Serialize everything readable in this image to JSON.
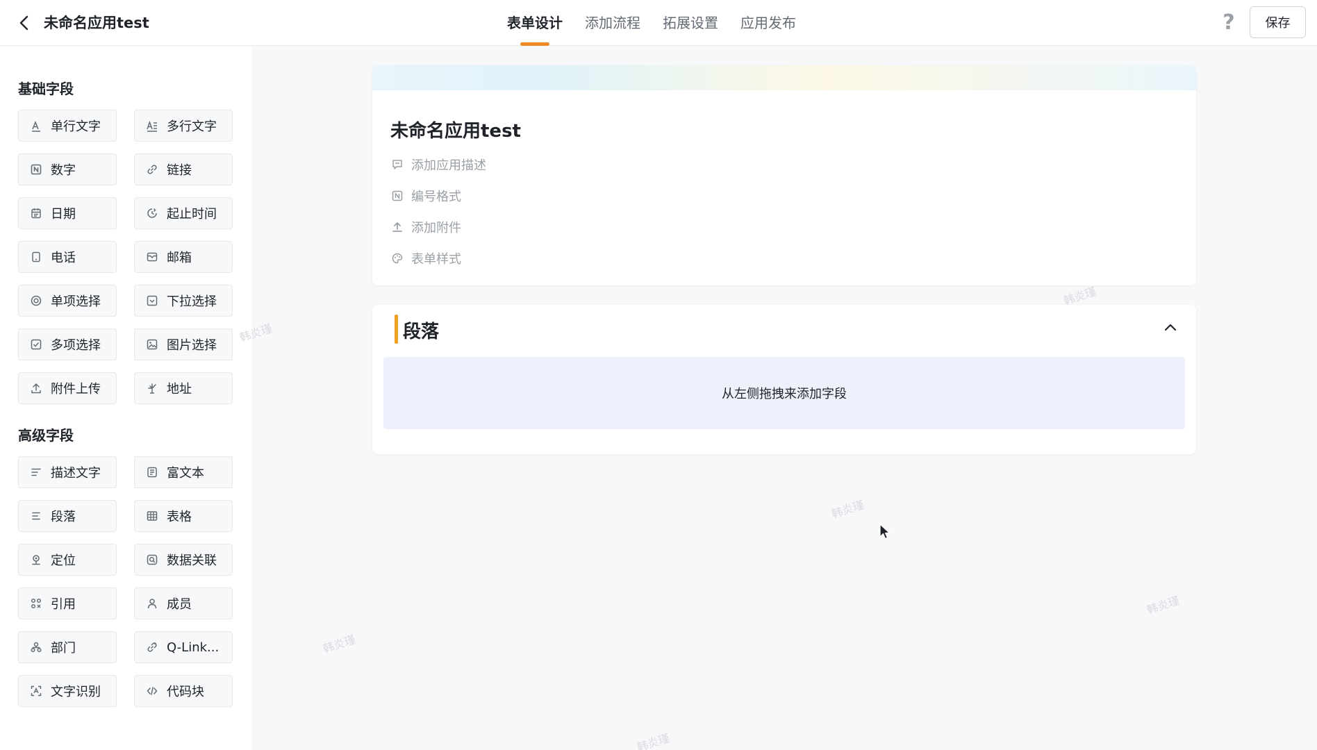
{
  "header": {
    "title": "未命名应用test",
    "tabs": [
      {
        "label": "表单设计",
        "active": true
      },
      {
        "label": "添加流程",
        "active": false
      },
      {
        "label": "拓展设置",
        "active": false
      },
      {
        "label": "应用发布",
        "active": false
      }
    ],
    "help": "?",
    "save_label": "保存"
  },
  "sidebar": {
    "basic_title": "基础字段",
    "basic_fields": [
      {
        "label": "单行文字",
        "icon": "text-icon"
      },
      {
        "label": "多行文字",
        "icon": "multiline-text-icon"
      },
      {
        "label": "数字",
        "icon": "number-icon"
      },
      {
        "label": "链接",
        "icon": "link-icon"
      },
      {
        "label": "日期",
        "icon": "calendar-icon"
      },
      {
        "label": "起止时间",
        "icon": "time-range-icon"
      },
      {
        "label": "电话",
        "icon": "phone-icon"
      },
      {
        "label": "邮箱",
        "icon": "mail-icon"
      },
      {
        "label": "单项选择",
        "icon": "radio-icon"
      },
      {
        "label": "下拉选择",
        "icon": "dropdown-icon"
      },
      {
        "label": "多项选择",
        "icon": "checkbox-icon"
      },
      {
        "label": "图片选择",
        "icon": "image-icon"
      },
      {
        "label": "附件上传",
        "icon": "upload-icon"
      },
      {
        "label": "地址",
        "icon": "address-icon"
      }
    ],
    "advanced_title": "高级字段",
    "advanced_fields": [
      {
        "label": "描述文字",
        "icon": "description-icon"
      },
      {
        "label": "富文本",
        "icon": "rich-text-icon"
      },
      {
        "label": "段落",
        "icon": "paragraph-icon"
      },
      {
        "label": "表格",
        "icon": "table-icon"
      },
      {
        "label": "定位",
        "icon": "location-icon"
      },
      {
        "label": "数据关联",
        "icon": "data-link-icon"
      },
      {
        "label": "引用",
        "icon": "reference-icon"
      },
      {
        "label": "成员",
        "icon": "member-icon"
      },
      {
        "label": "部门",
        "icon": "department-icon"
      },
      {
        "label": "Q-Link...",
        "icon": "qlink-icon"
      },
      {
        "label": "文字识别",
        "icon": "ocr-icon"
      },
      {
        "label": "代码块",
        "icon": "code-icon"
      }
    ]
  },
  "form": {
    "title": "未命名应用test",
    "options": [
      {
        "label": "添加应用描述",
        "icon": "comment-icon"
      },
      {
        "label": "编号格式",
        "icon": "number-format-icon"
      },
      {
        "label": "添加附件",
        "icon": "attach-upload-icon"
      },
      {
        "label": "表单样式",
        "icon": "palette-icon"
      }
    ]
  },
  "section": {
    "title": "段落",
    "drop_hint": "从左侧拖拽来添加字段"
  },
  "watermark": "韩炎瑾",
  "colors": {
    "accent": "#f08a24",
    "section_bar": "#f0a020",
    "drop_zone": "#eef1fb"
  }
}
